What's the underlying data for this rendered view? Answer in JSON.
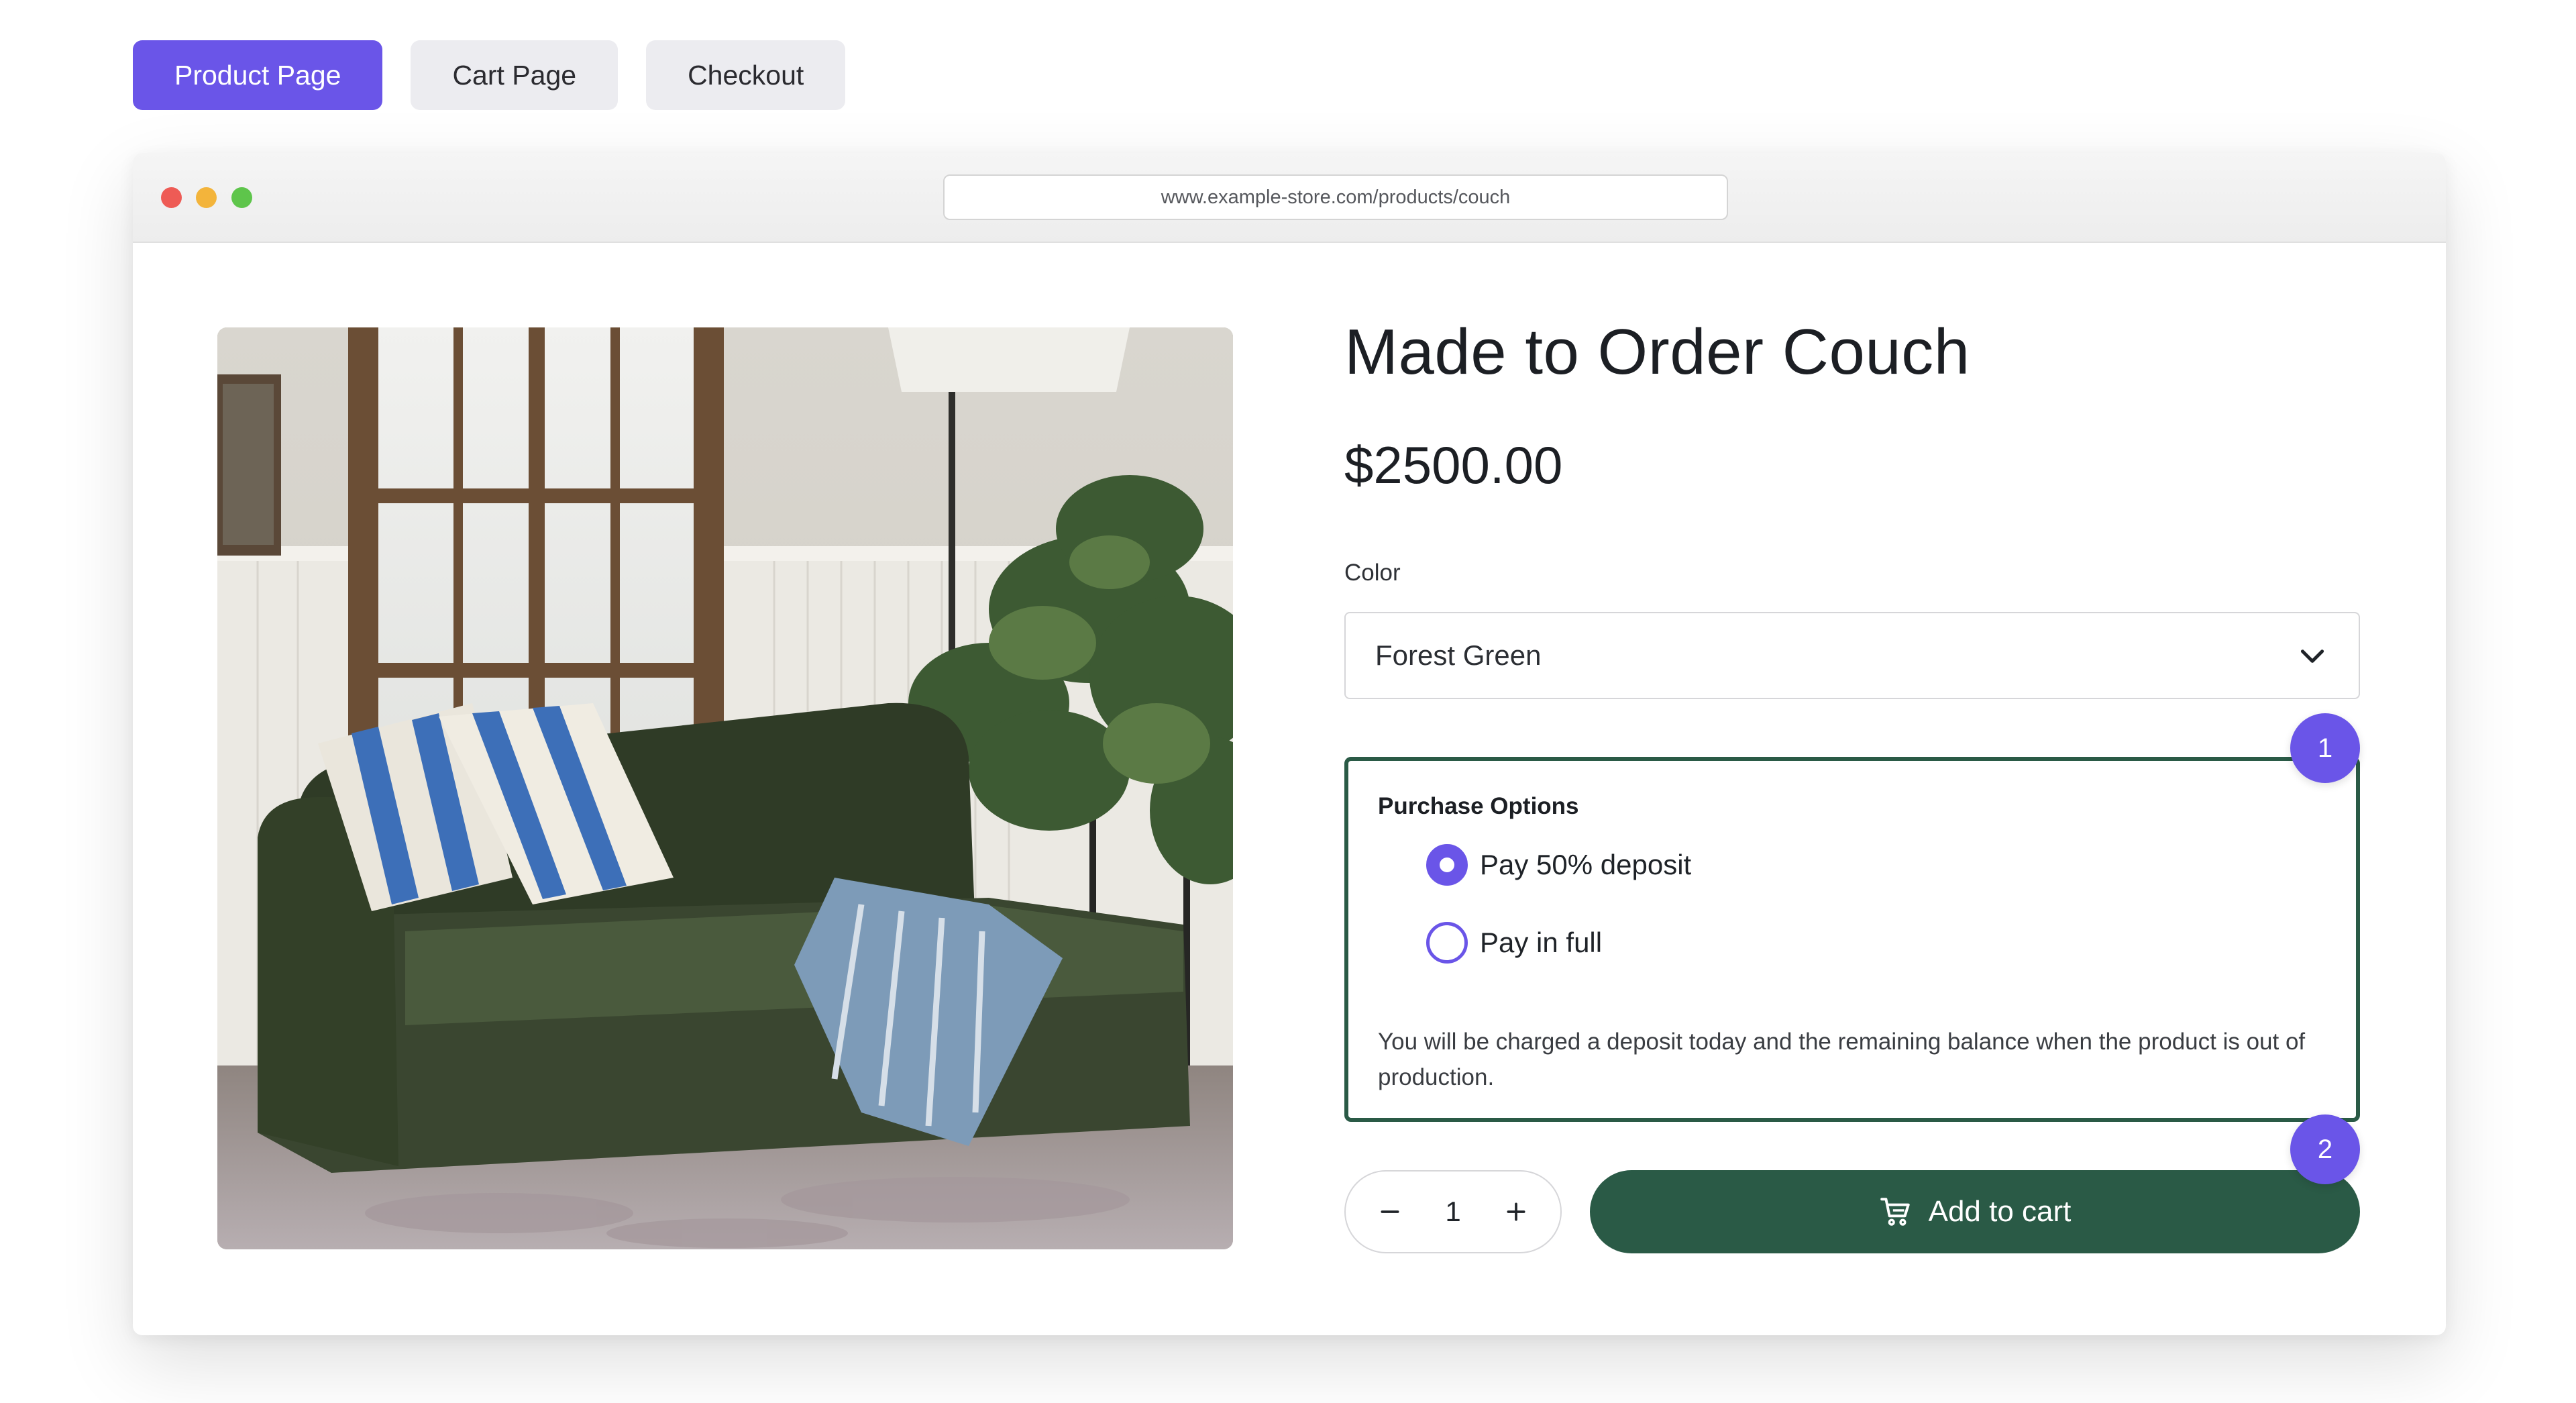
{
  "tabs": [
    {
      "label": "Product Page",
      "active": true
    },
    {
      "label": "Cart Page",
      "active": false
    },
    {
      "label": "Checkout",
      "active": false
    }
  ],
  "browser": {
    "url": "www.example-store.com/products/couch"
  },
  "product": {
    "title": "Made to Order Couch",
    "price": "$2500.00",
    "image_icon": "couch-photo"
  },
  "color": {
    "label": "Color",
    "selected": "Forest Green"
  },
  "purchase_options": {
    "title": "Purchase Options",
    "options": [
      {
        "label": "Pay 50% deposit",
        "selected": true
      },
      {
        "label": "Pay in full",
        "selected": false
      }
    ],
    "note": "You will be charged a deposit today and the remaining balance when the product is out of production."
  },
  "badges": [
    "1",
    "2"
  ],
  "quantity": {
    "value": "1"
  },
  "add_to_cart": {
    "label": "Add to cart",
    "icon": "cart-icon"
  },
  "colors": {
    "accent": "#6a55e8",
    "brand_green": "#2a5a46"
  }
}
